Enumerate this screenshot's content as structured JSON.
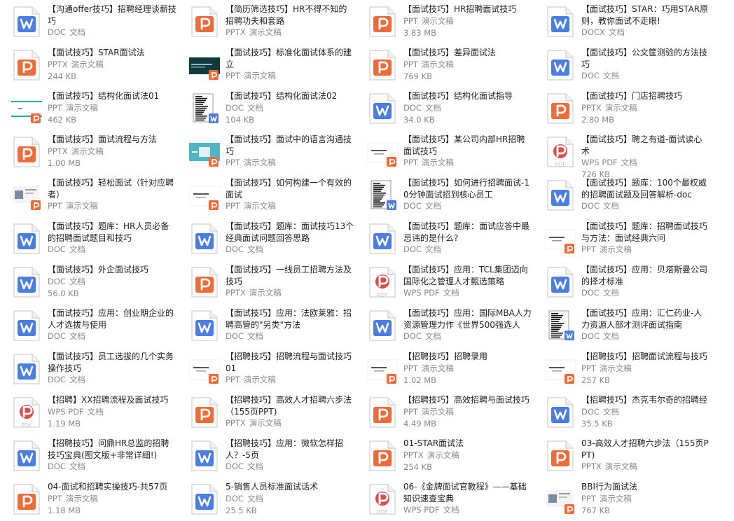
{
  "colors": {
    "doc": "#4a7ee5",
    "ppt": "#f06b3a",
    "pdf": "#e04a4a",
    "page": "#ffffff"
  },
  "items": [
    {
      "title": "【沟通offer技巧】招聘经理谈薪技巧",
      "ext": "DOC",
      "label": "文档",
      "size": "",
      "kind": "doc"
    },
    {
      "title": "【简历筛选技巧】HR不得不知的招聘功夫和套路",
      "ext": "PPTX",
      "label": "演示文稿",
      "size": "",
      "kind": "ppt"
    },
    {
      "title": "【面试技巧】HR招聘面试技巧",
      "ext": "PPT",
      "label": "演示文稿",
      "size": "3.83 MB",
      "kind": "ppt"
    },
    {
      "title": "【面试技巧】STAR：巧用STAR原则，教你面试不走眼!",
      "ext": "DOCX",
      "label": "文档",
      "size": "",
      "kind": "doc"
    },
    {
      "title": "【面试技巧】STAR面试法",
      "ext": "PPTX",
      "label": "演示文稿",
      "size": "244 KB",
      "kind": "ppt"
    },
    {
      "title": "【面试技巧】标准化面试体系的建立",
      "ext": "PPT",
      "label": "演示文稿",
      "size": "",
      "kind": "preview-dark"
    },
    {
      "title": "【面试技巧】差异面试法",
      "ext": "PPT",
      "label": "演示文稿",
      "size": "769 KB",
      "kind": "ppt"
    },
    {
      "title": "【面试技巧】公文筐测验的方法技巧",
      "ext": "DOC",
      "label": "文档",
      "size": "",
      "kind": "doc"
    },
    {
      "title": "【面试技巧】结构化面试法01",
      "ext": "PPT",
      "label": "演示文稿",
      "size": "462 KB",
      "kind": "preview-green"
    },
    {
      "title": "【面试技巧】结构化面试法02",
      "ext": "DOC",
      "label": "文档",
      "size": "104 KB",
      "kind": "preview-docpage"
    },
    {
      "title": "【面试技巧】结构化面试指导",
      "ext": "DOC",
      "label": "文档",
      "size": "34.0 KB",
      "kind": "doc"
    },
    {
      "title": "【面试技巧】门店招聘技巧",
      "ext": "PPTX",
      "label": "演示文稿",
      "size": "2.80 MB",
      "kind": "ppt"
    },
    {
      "title": "【面试技巧】面试流程与方法",
      "ext": "PPTX",
      "label": "演示文稿",
      "size": "1.00 MB",
      "kind": "ppt"
    },
    {
      "title": "【面试技巧】面试中的语言沟通技巧",
      "ext": "PPT",
      "label": "演示文稿",
      "size": "",
      "kind": "preview-teal"
    },
    {
      "title": "【面试技巧】某公司内部HR招聘面试技巧",
      "ext": "PPT",
      "label": "演示文稿",
      "size": "",
      "kind": "preview-white"
    },
    {
      "title": "【面试技巧】聘之有道-面试读心术",
      "ext": "WPS PDF",
      "label": "文档",
      "size": "726 KB",
      "kind": "pdf"
    },
    {
      "title": "【面试技巧】轻松面试（针对应聘者）",
      "ext": "PPT",
      "label": "演示文稿",
      "size": "",
      "kind": "preview-photo"
    },
    {
      "title": "【面试技巧】如何构建一个有效的面试",
      "ext": "PPT",
      "label": "演示文稿",
      "size": "",
      "kind": "preview-white"
    },
    {
      "title": "【面试技巧】如何进行招聘面试-10分钟面试招到核心员工",
      "ext": "DOC",
      "label": "文档",
      "size": "",
      "kind": "preview-docpage"
    },
    {
      "title": "【面试技巧】题库：100个最权威的招聘面试题及回答解析-doc",
      "ext": "DOC",
      "label": "文档",
      "size": "",
      "kind": "doc"
    },
    {
      "title": "【面试技巧】题库：HR人员必备的招聘面试题目和技巧",
      "ext": "DOC",
      "label": "文档",
      "size": "",
      "kind": "doc"
    },
    {
      "title": "【面试技巧】题库：面试技巧13个经典面试问题回答思路",
      "ext": "DOC",
      "label": "文档",
      "size": "",
      "kind": "doc"
    },
    {
      "title": "【面试技巧】题库：面试应答中最忌讳的是什么?",
      "ext": "DOC",
      "label": "文档",
      "size": "",
      "kind": "doc"
    },
    {
      "title": "【面试技巧】题库：招聘面试技巧与方法：面试经典六问",
      "ext": "PPT",
      "label": "演示文稿",
      "size": "",
      "kind": "preview-white"
    },
    {
      "title": "【面试技巧】外企面试技巧",
      "ext": "DOC",
      "label": "文档",
      "size": "56.0 KB",
      "kind": "doc"
    },
    {
      "title": "【面试技巧】一线员工招聘方法及技巧",
      "ext": "PPTX",
      "label": "演示文稿",
      "size": "",
      "kind": "ppt"
    },
    {
      "title": "【面试技巧】应用：TCL集团迈向国际化之管理人才甄选策略",
      "ext": "WPS PDF",
      "label": "文档",
      "size": "",
      "kind": "pdf"
    },
    {
      "title": "【面试技巧】应用：贝塔斯曼公司的择才标准",
      "ext": "DOC",
      "label": "文档",
      "size": "",
      "kind": "doc"
    },
    {
      "title": "【面试技巧】应用：创业期企业的人才选拔与使用",
      "ext": "DOC",
      "label": "文档",
      "size": "",
      "kind": "doc"
    },
    {
      "title": "【面试技巧】应用：法欧莱雅：招聘高管的\"另类\"方法",
      "ext": "DOC",
      "label": "文档",
      "size": "",
      "kind": "doc"
    },
    {
      "title": "【面试技巧】应用：国际MBA人力资源管理力作《世界500强选人标...",
      "ext": "DOC",
      "label": "文档",
      "size": "",
      "kind": "doc"
    },
    {
      "title": "【面试技巧】应用：汇仁药业-人力资源人部才测评面试指南",
      "ext": "DOC",
      "label": "文档",
      "size": "",
      "kind": "preview-docpage"
    },
    {
      "title": "【面试技巧】员工选拔的几个实务操作技巧",
      "ext": "DOC",
      "label": "文档",
      "size": "",
      "kind": "doc"
    },
    {
      "title": "【招聘技巧】招聘流程与面试技巧01",
      "ext": "PPT",
      "label": "演示文稿",
      "size": "",
      "kind": "preview-white"
    },
    {
      "title": "【招聘技巧】招聘录用",
      "ext": "PPT",
      "label": "演示文稿",
      "size": "1.02 MB",
      "kind": "preview-white"
    },
    {
      "title": "【招聘技巧】招聘面试流程与技巧",
      "ext": "PPT",
      "label": "演示文稿",
      "size": "257 KB",
      "kind": "preview-white"
    },
    {
      "title": "【招聘】XX招聘流程及面试技巧",
      "ext": "WPS PDF",
      "label": "文档",
      "size": "1.19 MB",
      "kind": "pdf"
    },
    {
      "title": "【招聘技巧】高效人才招聘六步法（155页PPT)",
      "ext": "PPTX",
      "label": "演示文稿",
      "size": "",
      "kind": "ppt"
    },
    {
      "title": "【招聘技巧】高效招聘与面试技巧",
      "ext": "PPT",
      "label": "演示文稿",
      "size": "4.49 MB",
      "kind": "ppt"
    },
    {
      "title": "【招聘技巧】杰克韦尔奇的招聘经",
      "ext": "DOC",
      "label": "文档",
      "size": "35.5 KB",
      "kind": "doc"
    },
    {
      "title": "【招聘技巧】问鼎HR总监的招聘技巧宝典(图文版+非常详细!)",
      "ext": "DOC",
      "label": "文档",
      "size": "",
      "kind": "doc"
    },
    {
      "title": "【招聘技巧】应用：微软怎样招人？-5页",
      "ext": "DOC",
      "label": "文档",
      "size": "",
      "kind": "doc"
    },
    {
      "title": "01-STAR面试法",
      "ext": "PPTX",
      "label": "演示文稿",
      "size": "254 KB",
      "kind": "ppt"
    },
    {
      "title": "03-高效人才招聘六步法（155页PPT)",
      "ext": "PPTX",
      "label": "演示文稿",
      "size": "",
      "kind": "ppt"
    },
    {
      "title": "04-面试和招聘实操技巧-共57页",
      "ext": "PPT",
      "label": "演示文稿",
      "size": "1.18 MB",
      "kind": "ppt"
    },
    {
      "title": "5-销售人员标准面试话术",
      "ext": "DOC",
      "label": "文档",
      "size": "25.5 KB",
      "kind": "doc"
    },
    {
      "title": "06-《金牌面试官教程》——基础知识速查宝典",
      "ext": "WPS PDF",
      "label": "文档",
      "size": "",
      "kind": "pdf"
    },
    {
      "title": "BBI行为面试法",
      "ext": "PPT",
      "label": "演示文稿",
      "size": "767 KB",
      "kind": "preview-photo"
    }
  ]
}
